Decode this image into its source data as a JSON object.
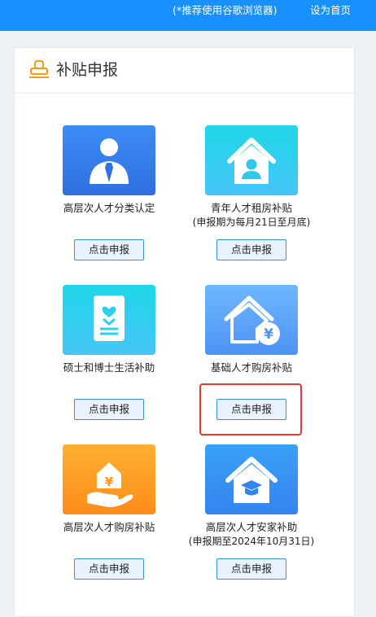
{
  "topbar": {
    "hint": "(*推荐使用谷歌浏览器)",
    "set_home": "设为首页"
  },
  "panel": {
    "icon": "stamp-icon",
    "title": "补贴申报"
  },
  "cards": [
    {
      "title": "高层次人才分类认定",
      "sub": "",
      "icon": "person-tie-icon",
      "color": "#3580ef",
      "button": "点击申报"
    },
    {
      "title": "青年人才租房补贴",
      "sub": "(申报期为每月21日至月底)",
      "icon": "house-person-icon",
      "color": "#2ccfee",
      "button": "点击申报"
    },
    {
      "title": "硕士和博士生活补助",
      "sub": "",
      "icon": "certificate-icon",
      "color": "#2ccfee",
      "button": "点击申报"
    },
    {
      "title": "基础人才购房补贴",
      "sub": "",
      "icon": "house-yen-icon",
      "color": "#5ea5fb",
      "button": "点击申报"
    },
    {
      "title": "高层次人才购房补贴",
      "sub": "",
      "icon": "hand-house-yen-icon",
      "color": "#ff9d24",
      "button": "点击申报"
    },
    {
      "title": "高层次人才安家补助",
      "sub": "(申报期至2024年10月31日)",
      "icon": "house-graduation-cap-icon",
      "color": "#3d92f3",
      "button": "点击申报"
    }
  ]
}
